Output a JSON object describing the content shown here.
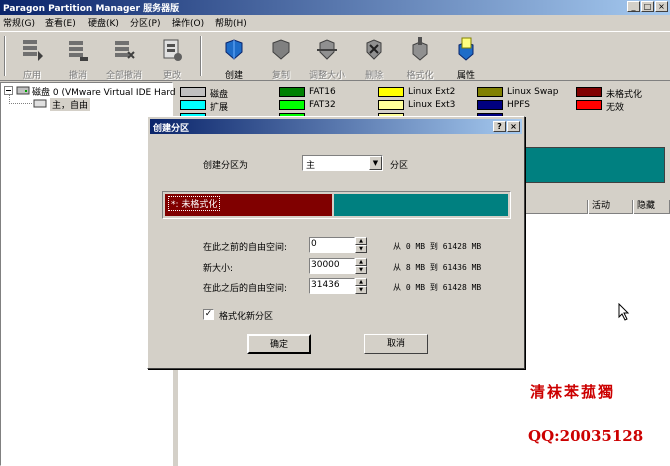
{
  "window": {
    "title": "Paragon Partition Manager 服务器版",
    "buttons": [
      "_",
      "□",
      "×"
    ]
  },
  "menu": [
    "常规(G)",
    "查看(E)",
    "硬盘(K)",
    "分区(P)",
    "操作(O)",
    "帮助(H)"
  ],
  "toolbar": {
    "group1": [
      {
        "label": "应用",
        "icon": "apply-icon",
        "enabled": false
      },
      {
        "label": "撤消",
        "icon": "undo-icon",
        "enabled": false
      },
      {
        "label": "全部撤消",
        "icon": "undo-all-icon",
        "enabled": false
      },
      {
        "label": "更改",
        "icon": "change-icon",
        "enabled": false
      }
    ],
    "group2": [
      {
        "label": "创建",
        "icon": "create-icon",
        "enabled": true
      },
      {
        "label": "复制",
        "icon": "copy-icon",
        "enabled": false
      },
      {
        "label": "调整大小",
        "icon": "resize-icon",
        "enabled": false
      },
      {
        "label": "删除",
        "icon": "delete-icon",
        "enabled": false
      },
      {
        "label": "格式化",
        "icon": "format-icon",
        "enabled": false
      },
      {
        "label": "属性",
        "icon": "properties-icon",
        "enabled": true
      }
    ]
  },
  "tree": {
    "disk": "磁盘 0 (VMware Virtual IDE Hard",
    "partition": "主，自由"
  },
  "legend": [
    {
      "label": "磁盘",
      "color": "#c0c0c0"
    },
    {
      "label": "FAT16",
      "color": "#008000"
    },
    {
      "label": "Linux Ext2",
      "color": "#ffff00"
    },
    {
      "label": "Linux Swap",
      "color": "#808000"
    },
    {
      "label": "未格式化",
      "color": "#800000"
    },
    {
      "label": "扩展",
      "color": "#00ffff"
    },
    {
      "label": "FAT32",
      "color": "#00ff00"
    },
    {
      "label": "Linux Ext3",
      "color": "#ffff99"
    },
    {
      "label": "HPFS",
      "color": "#000080"
    },
    {
      "label": "无效",
      "color": "#ff0000"
    }
  ],
  "list": {
    "headers": [
      "活动",
      "隐藏"
    ]
  },
  "watermark": {
    "line1": "清袜苯菰獨",
    "line2": "QQ:20035128"
  },
  "dialog": {
    "title": "创建分区",
    "help_button": "?",
    "close_button": "×",
    "create_as_label": "创建分区为",
    "create_as_value": "主",
    "partition_suffix": "分区",
    "bar_label": "*: 未格式化",
    "colors": {
      "new_partition": "#800000",
      "free_space": "#008080"
    },
    "fields": [
      {
        "label": "在此之前的自由空间:",
        "value": "0",
        "range": "从 0 MB 到 61428 MB"
      },
      {
        "label": "新大小:",
        "value": "30000",
        "range": "从 8 MB 到 61436 MB"
      },
      {
        "label": "在此之后的自由空间:",
        "value": "31436",
        "range": "从 0 MB 到 61428 MB"
      }
    ],
    "format_checkbox": {
      "label": "格式化新分区",
      "checked": true,
      "mark": "✓"
    },
    "ok": "确定",
    "cancel": "取消"
  }
}
